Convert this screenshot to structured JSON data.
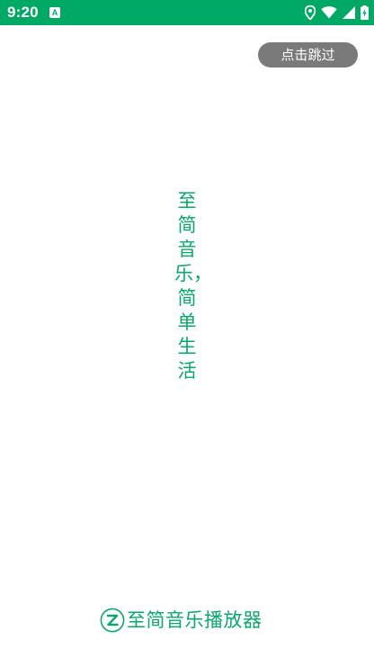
{
  "status_bar": {
    "time": "9:20",
    "notification_icon": "a-icon",
    "icons": [
      "location-icon",
      "wifi-icon",
      "signal-icon",
      "battery-charging-icon"
    ],
    "background_color": "#00a865"
  },
  "skip_button": {
    "label": "点击跳过"
  },
  "slogan": {
    "text": "至简音乐，简单生活"
  },
  "brand": {
    "logo_icon": "z-logo-icon",
    "name": "至简音乐播放器",
    "color": "#0aa66a"
  }
}
